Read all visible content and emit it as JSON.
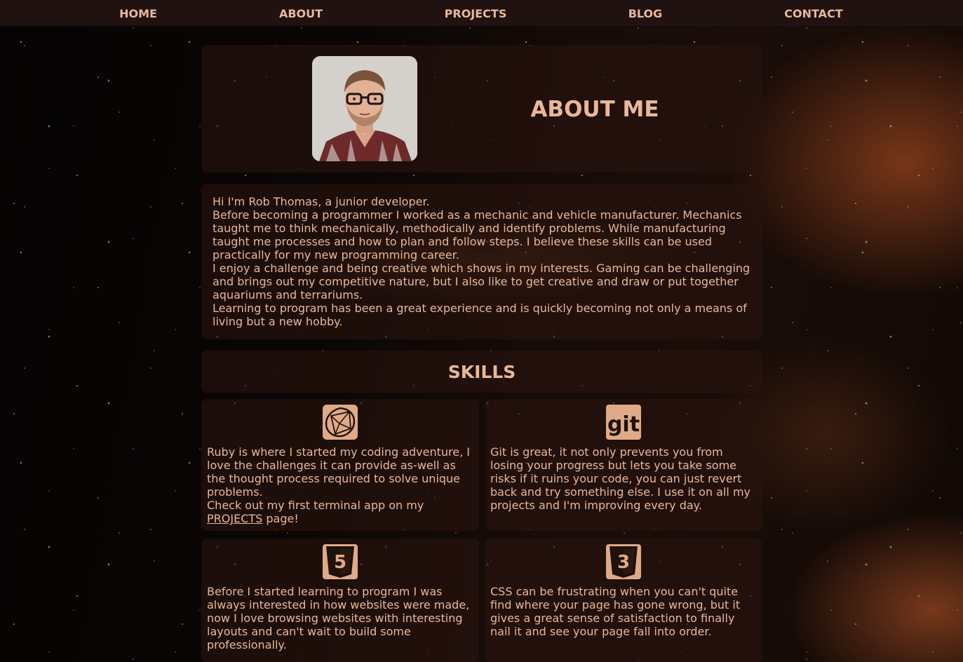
{
  "nav": {
    "items": [
      {
        "label": "HOME"
      },
      {
        "label": "ABOUT"
      },
      {
        "label": "PROJECTS"
      },
      {
        "label": "BLOG"
      },
      {
        "label": "CONTACT"
      }
    ]
  },
  "about": {
    "title": "ABOUT ME",
    "paragraphs": [
      "Hi I'm Rob Thomas, a junior developer.",
      "Before becoming a programmer I worked as a mechanic and vehicle manufacturer. Mechanics taught me to think mechanically, methodically and identify problems. While manufacturing taught me processes and how to plan and follow steps. I believe these skills can be used practically for my new programming career.",
      "I enjoy a challenge and being creative which shows in my interests. Gaming can be challenging and brings out my competitive nature, but I also like to get creative and draw or put together aquariums and terrariums.",
      "Learning to program has been a great experience and is quickly becoming not only a means of living but a new hobby."
    ]
  },
  "skills": {
    "title": "SKILLS",
    "ruby": {
      "icon": "ruby-icon",
      "text": "Ruby is where I started my coding adventure, I love the challenges it can provide as-well as the thought process required to solve unique problems.",
      "cta_prefix": "Check out my first terminal app on my",
      "cta_link": "PROJECTS",
      "cta_suffix": " page!"
    },
    "git": {
      "icon": "git-icon",
      "icon_text": "git",
      "text": "Git is great, it not only prevents you from losing your progress but lets you take some risks if it ruins your code, you can just revert back and try something else. I use it on all my projects and I'm improving every day."
    },
    "html": {
      "icon": "html5-icon",
      "icon_text": "5",
      "text": "Before I started learning to program I was always interested in how websites were made, now I love browsing websites with interesting layouts and can't wait to build some professionally."
    },
    "css": {
      "icon": "css3-icon",
      "icon_text": "3",
      "text": "CSS can be frustrating when you can't quite find where your page has gone wrong, but it gives a great sense of satisfaction to finally nail it and see your page fall into order."
    }
  },
  "colors": {
    "text": "#e8b898",
    "nav_bg": "#1f1210",
    "icon_bg": "#e0aa88"
  }
}
